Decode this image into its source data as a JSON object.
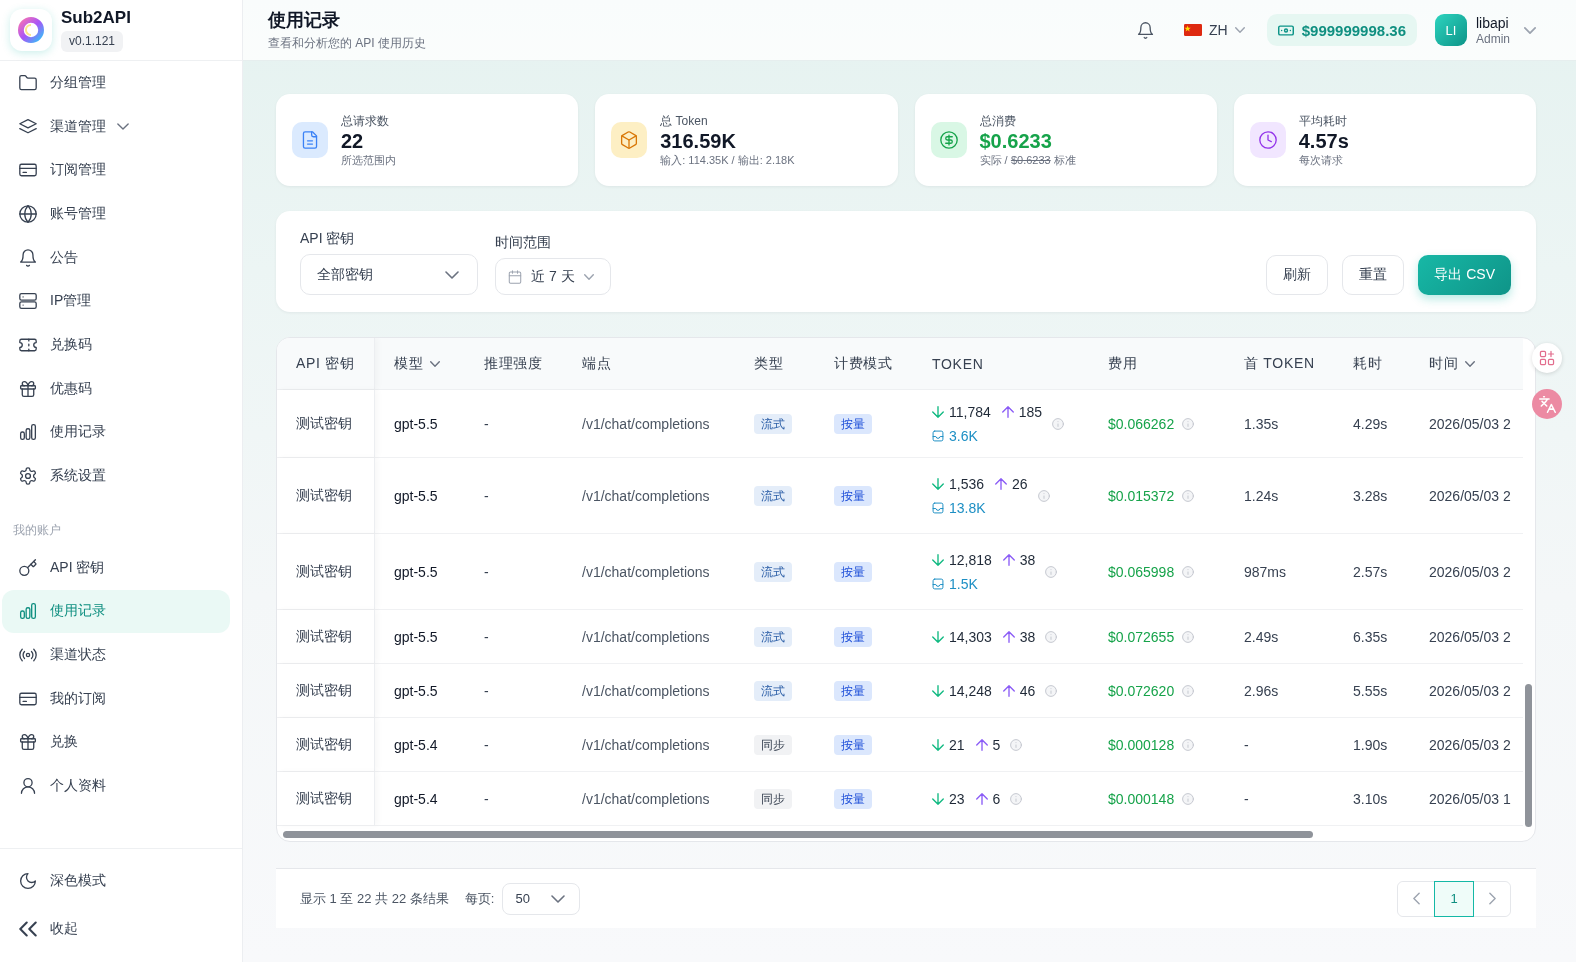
{
  "sidebar": {
    "brand": {
      "name": "Sub2API",
      "version": "v0.1.121"
    },
    "sections": [
      {
        "items": [
          {
            "label": "分组管理",
            "selected": false
          },
          {
            "label": "渠道管理",
            "selected": false,
            "expanded": false
          },
          {
            "label": "订阅管理",
            "selected": false
          },
          {
            "label": "账号管理",
            "selected": false
          },
          {
            "label": "公告",
            "selected": false
          },
          {
            "label": "IP管理",
            "selected": false
          },
          {
            "label": "兑换码",
            "selected": false
          },
          {
            "label": "优惠码",
            "selected": false
          },
          {
            "label": "使用记录",
            "selected": false
          },
          {
            "label": "系统设置",
            "selected": false
          }
        ]
      },
      {
        "title": "我的账户",
        "items": [
          {
            "label": "API 密钥",
            "selected": false
          },
          {
            "label": "使用记录",
            "selected": true
          },
          {
            "label": "渠道状态",
            "selected": false
          },
          {
            "label": "我的订阅",
            "selected": false
          },
          {
            "label": "兑换",
            "selected": false
          },
          {
            "label": "个人资料",
            "selected": false
          }
        ]
      }
    ],
    "footer": [
      {
        "label": "深色模式"
      },
      {
        "label": "收起"
      }
    ]
  },
  "header": {
    "title": "使用记录",
    "subtitle": "查看和分析您的 API 使用历史",
    "language": "ZH",
    "balance": "$999999998.36",
    "user": {
      "initials": "LI",
      "name": "libapi",
      "role": "Admin"
    }
  },
  "stats": [
    {
      "kind": "requests",
      "label": "总请求数",
      "value": "22",
      "sub": [
        {
          "text": "所选范围内",
          "struck": false
        }
      ]
    },
    {
      "kind": "tokens",
      "label": "总 Token",
      "value": "316.59K",
      "sub": [
        {
          "text": "输入: 114.35K / 输出: 2.18K",
          "struck": false
        }
      ]
    },
    {
      "kind": "cost",
      "label": "总消费",
      "value": "$0.6233",
      "sub": [
        {
          "text": "实际 /",
          "struck": false
        },
        {
          "text": "$0.6233",
          "struck": true
        },
        {
          "text": "标准",
          "struck": false
        }
      ]
    },
    {
      "kind": "duration",
      "label": "平均耗时",
      "value": "4.57s",
      "sub": [
        {
          "text": "每次请求",
          "struck": false
        }
      ]
    }
  ],
  "filters": {
    "fields": [
      {
        "kind": "select",
        "label": "API 密钥",
        "value": "全部密钥"
      },
      {
        "kind": "date",
        "label": "时间范围",
        "value": "近 7 天"
      }
    ],
    "buttons": [
      {
        "kind": "secondary",
        "label": "刷新"
      },
      {
        "kind": "secondary",
        "label": "重置"
      },
      {
        "kind": "primary",
        "label": "导出 CSV"
      }
    ]
  },
  "table": {
    "columns": [
      {
        "label": "API 密钥",
        "sortable": false
      },
      {
        "label": "模型",
        "sortable": true
      },
      {
        "label": "推理强度",
        "sortable": false
      },
      {
        "label": "端点",
        "sortable": false
      },
      {
        "label": "类型",
        "sortable": false
      },
      {
        "label": "计费模式",
        "sortable": false
      },
      {
        "label": "TOKEN",
        "sortable": false
      },
      {
        "label": "费用",
        "sortable": false
      },
      {
        "label": "首 TOKEN",
        "sortable": false
      },
      {
        "label": "耗时",
        "sortable": false
      },
      {
        "label": "时间",
        "sortable": true
      }
    ],
    "rows": [
      {
        "key": "测试密钥",
        "model": "gpt-5.5",
        "reasoning": "-",
        "endpoint": "/v1/chat/completions",
        "type": {
          "label": "流式",
          "kind": "stream"
        },
        "billing": "按量",
        "tokens": {
          "input": "11,784",
          "output": "185",
          "cache": "3.6K"
        },
        "cost": "$0.066262",
        "first_token": "1.35s",
        "duration": "4.29s",
        "time": "2026/05/03 2"
      },
      {
        "key": "测试密钥",
        "model": "gpt-5.5",
        "reasoning": "-",
        "endpoint": "/v1/chat/completions",
        "type": {
          "label": "流式",
          "kind": "stream"
        },
        "billing": "按量",
        "tokens": {
          "input": "1,536",
          "output": "26",
          "cache": "13.8K"
        },
        "cost": "$0.015372",
        "first_token": "1.24s",
        "duration": "3.28s",
        "time": "2026/05/03 2"
      },
      {
        "key": "测试密钥",
        "model": "gpt-5.5",
        "reasoning": "-",
        "endpoint": "/v1/chat/completions",
        "type": {
          "label": "流式",
          "kind": "stream"
        },
        "billing": "按量",
        "tokens": {
          "input": "12,818",
          "output": "38",
          "cache": "1.5K"
        },
        "cost": "$0.065998",
        "first_token": "987ms",
        "duration": "2.57s",
        "time": "2026/05/03 2"
      },
      {
        "key": "测试密钥",
        "model": "gpt-5.5",
        "reasoning": "-",
        "endpoint": "/v1/chat/completions",
        "type": {
          "label": "流式",
          "kind": "stream"
        },
        "billing": "按量",
        "tokens": {
          "input": "14,303",
          "output": "38"
        },
        "cost": "$0.072655",
        "first_token": "2.49s",
        "duration": "6.35s",
        "time": "2026/05/03 2"
      },
      {
        "key": "测试密钥",
        "model": "gpt-5.5",
        "reasoning": "-",
        "endpoint": "/v1/chat/completions",
        "type": {
          "label": "流式",
          "kind": "stream"
        },
        "billing": "按量",
        "tokens": {
          "input": "14,248",
          "output": "46"
        },
        "cost": "$0.072620",
        "first_token": "2.96s",
        "duration": "5.55s",
        "time": "2026/05/03 2"
      },
      {
        "key": "测试密钥",
        "model": "gpt-5.4",
        "reasoning": "-",
        "endpoint": "/v1/chat/completions",
        "type": {
          "label": "同步",
          "kind": "sync"
        },
        "billing": "按量",
        "tokens": {
          "input": "21",
          "output": "5"
        },
        "cost": "$0.000128",
        "first_token": "-",
        "duration": "1.90s",
        "time": "2026/05/03 2"
      },
      {
        "key": "测试密钥",
        "model": "gpt-5.4",
        "reasoning": "-",
        "endpoint": "/v1/chat/completions",
        "type": {
          "label": "同步",
          "kind": "sync"
        },
        "billing": "按量",
        "tokens": {
          "input": "23",
          "output": "6"
        },
        "cost": "$0.000148",
        "first_token": "-",
        "duration": "3.10s",
        "time": "2026/05/03 1"
      }
    ]
  },
  "pagination": {
    "summary": "显示 1 至 22 共 22 条结果",
    "per_page_label": "每页:",
    "per_page": "50",
    "pages": [
      {
        "label": "1",
        "selected": true
      }
    ]
  }
}
